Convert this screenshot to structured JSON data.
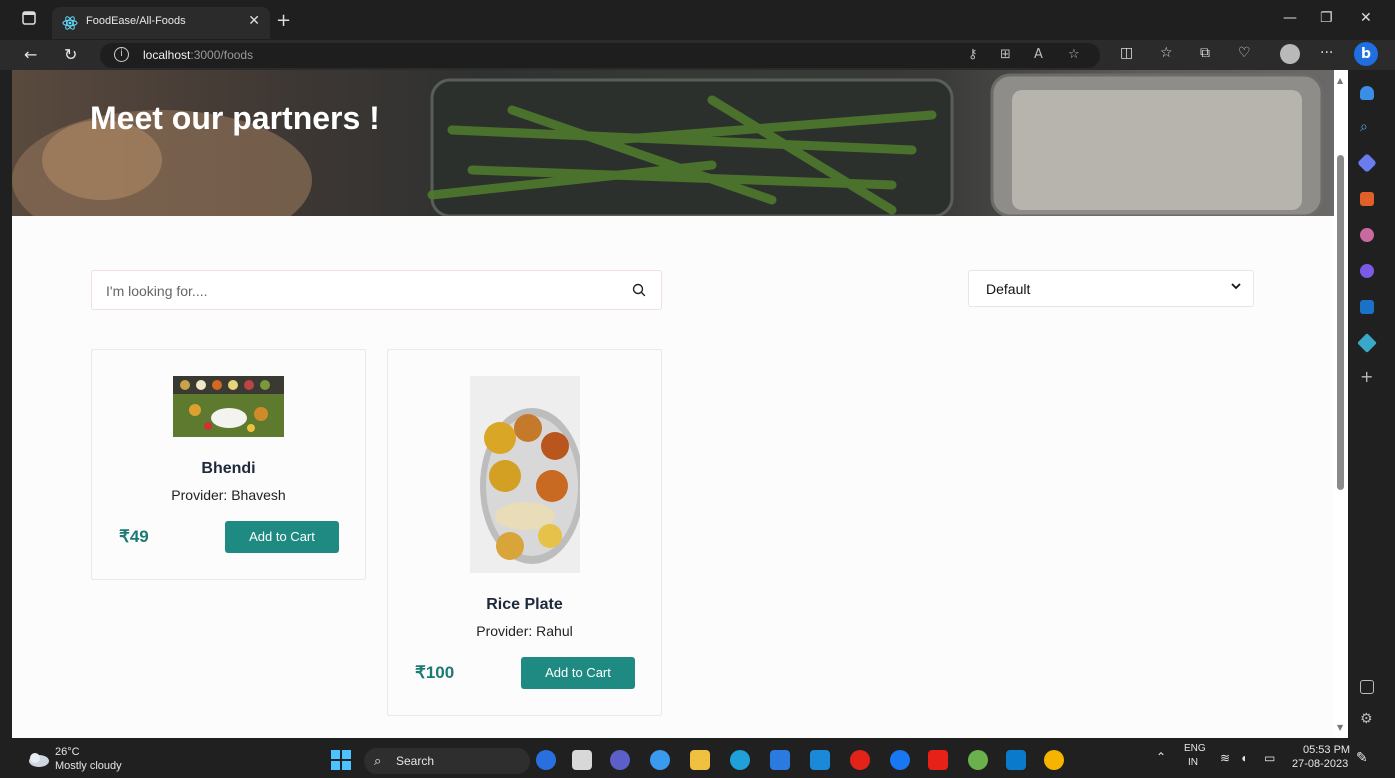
{
  "browser": {
    "tab_title": "FoodEase/All-Foods",
    "url_host": "localhost",
    "url_rest": ":3000/foods"
  },
  "page": {
    "hero_title": "Meet our partners !",
    "search_placeholder": "I'm looking for....",
    "sort_selected": "Default",
    "products": [
      {
        "name": "Bhendi",
        "provider": "Provider: Bhavesh",
        "price": "₹49",
        "button": "Add to Cart"
      },
      {
        "name": "Rice Plate",
        "provider": "Provider: Rahul",
        "price": "₹100",
        "button": "Add to Cart"
      }
    ]
  },
  "taskbar": {
    "weather_temp": "26°C",
    "weather_desc": "Mostly cloudy",
    "search_label": "Search",
    "lang_top": "ENG",
    "lang_bottom": "IN",
    "time": "05:53 PM",
    "date": "27-08-2023"
  },
  "colors": {
    "accent": "#1e8a82",
    "price": "#1c7a74"
  }
}
